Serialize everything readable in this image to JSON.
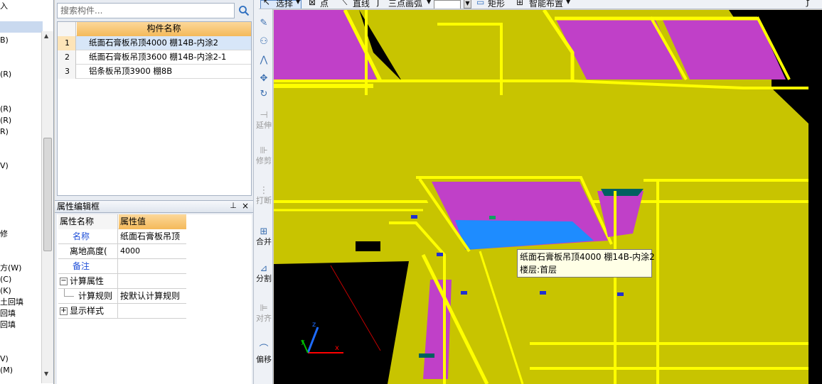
{
  "left_tree": {
    "items": [
      {
        "text": "入"
      },
      {
        "text": "B)"
      },
      {
        "text": "(R)"
      },
      {
        "text": "(R)"
      },
      {
        "text": "(R)"
      },
      {
        "text": "R)"
      },
      {
        "text": "V)"
      },
      {
        "text": "修"
      },
      {
        "text": "方(W)"
      },
      {
        "text": "(C)"
      },
      {
        "text": "(K)"
      },
      {
        "text": "土回填"
      },
      {
        "text": "回填"
      },
      {
        "text": "回填"
      },
      {
        "text": "V)"
      },
      {
        "text": "(M)"
      }
    ]
  },
  "search": {
    "placeholder": "搜索构件..."
  },
  "component_list": {
    "header": "构件名称",
    "rows": [
      {
        "index": "1",
        "name": "纸面石膏板吊顶4000 棚14B-内涂2"
      },
      {
        "index": "2",
        "name": "纸面石膏板吊顶3600 棚14B-内涂2-1"
      },
      {
        "index": "3",
        "name": "铝条板吊顶3900 棚8B"
      }
    ]
  },
  "property_panel": {
    "title": "属性编辑框",
    "pin": "⊥",
    "close": "×",
    "header_name": "属性名称",
    "header_value": "属性值",
    "rows": [
      {
        "name": "名称",
        "value": "纸面石膏板吊顶"
      },
      {
        "name": "离地高度(",
        "value": "4000"
      },
      {
        "name": "备注",
        "value": ""
      },
      {
        "name": "计算属性",
        "value": "",
        "toggle": "−"
      },
      {
        "name": "计算规则",
        "value": "按默认计算规则"
      },
      {
        "name": "显示样式",
        "value": "",
        "toggle": "+"
      }
    ]
  },
  "vertical_toolbar": {
    "tools": [
      {
        "label": "",
        "icon": "brush-icon"
      },
      {
        "label": "",
        "icon": "copy-icon"
      },
      {
        "label": "",
        "icon": "mirror-icon"
      },
      {
        "label": "",
        "icon": "move-icon"
      },
      {
        "label": "",
        "icon": "rotate-icon"
      },
      {
        "label": "延伸",
        "icon": "extend-icon"
      },
      {
        "label": "修剪",
        "icon": "trim-icon"
      },
      {
        "label": "打断",
        "icon": "break-icon"
      },
      {
        "label": "合并",
        "icon": "merge-icon"
      },
      {
        "label": "分割",
        "icon": "split-icon"
      },
      {
        "label": "对齐",
        "icon": "align-icon"
      },
      {
        "label": "偏移",
        "icon": "offset-icon"
      }
    ]
  },
  "top_toolbar": {
    "select": "选择",
    "point": "点",
    "line": "直线",
    "arc": "三点画弧",
    "rect": "矩形",
    "smart": "智能布置"
  },
  "viewport": {
    "tooltip_line1": "纸面石膏板吊顶4000 棚14B-内涂2",
    "tooltip_line2": "楼层:首层",
    "colors": {
      "wall": "#c8c400",
      "wall_edge": "#ffff00",
      "ceiling": "#c040c8",
      "selected": "#1e8cff",
      "background": "#000000"
    }
  }
}
